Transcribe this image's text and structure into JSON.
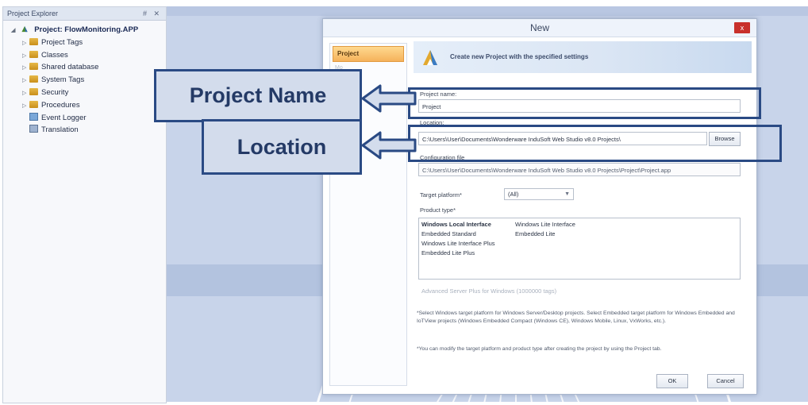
{
  "explorer": {
    "title": "Project Explorer",
    "controls": "# ✕",
    "root": "Project: FlowMonitoring.APP",
    "items": [
      {
        "label": "Project Tags",
        "icon": "folder-icon"
      },
      {
        "label": "Classes",
        "icon": "folder-icon"
      },
      {
        "label": "Shared database",
        "icon": "folder-icon"
      },
      {
        "label": "System Tags",
        "icon": "folder-icon"
      },
      {
        "label": "Security",
        "icon": "folder-icon"
      },
      {
        "label": "Procedures",
        "icon": "folder-icon"
      },
      {
        "label": "Event Logger",
        "icon": "event-logger-icon"
      },
      {
        "label": "Translation",
        "icon": "translation-icon"
      }
    ]
  },
  "dialog": {
    "title": "New",
    "close": "x",
    "nav_selected": "Project",
    "nav_faint": "Mo",
    "banner": "Create new Project with the specified settings",
    "project_name_label": "Project name:",
    "project_name_value": "Project",
    "location_label": "Location:",
    "location_value": "C:\\Users\\User\\Documents\\Wonderware InduSoft Web Studio v8.0 Projects\\",
    "browse": "Browse",
    "config_label": "Configuration file",
    "config_value": "C:\\Users\\User\\Documents\\Wonderware InduSoft Web Studio v8.0 Projects\\Project\\Project.app",
    "target_label": "Target platform*",
    "target_value": "(All)",
    "product_label": "Product type*",
    "products": [
      "Windows Local Interface",
      "Embedded Standard",
      "Windows Lite Interface Plus",
      "Embedded Lite Plus",
      "Windows Lite Interface",
      "Embedded Lite"
    ],
    "advanced": "Advanced Server Plus for Windows (1000000 tags)",
    "note1": "*Select Windows target platform for Windows Server/Desktop projects. Select Embedded target platform for Windows Embedded and IoTView projects (Windows Embedded Compact (Windows CE), Windows Mobile, Linux, VxWorks, etc.).",
    "note2": "*You can modify the target platform and product type after creating the project by using the Project tab.",
    "ok": "OK",
    "cancel": "Cancel"
  },
  "callouts": {
    "project_name": "Project Name",
    "location": "Location"
  },
  "colors": {
    "callout_border": "#2a4a84",
    "callout_fill": "#d3dcec",
    "nav_selected": "#f5b25b"
  }
}
